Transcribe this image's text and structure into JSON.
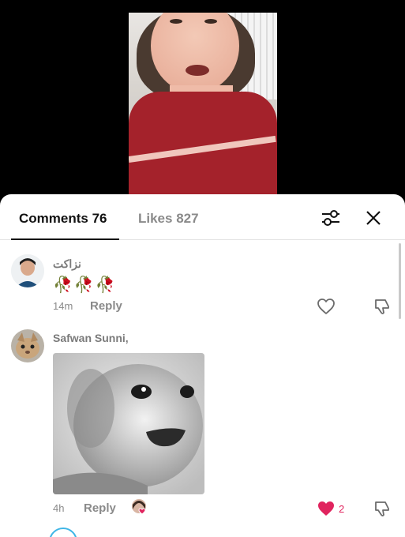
{
  "tabs": {
    "comments_label": "Comments 76",
    "likes_label": "Likes 827"
  },
  "comments": [
    {
      "username": "نزاکت",
      "emoji_text": "🥀🥀🥀",
      "time": "14m",
      "reply_label": "Reply"
    },
    {
      "username": "Safwan Sunni,",
      "time": "4h",
      "reply_label": "Reply",
      "like_count": "2",
      "liked": true
    }
  ],
  "colors": {
    "accent_like": "#e0245e",
    "muted": "#8a8a8a"
  },
  "icons": [
    "filter-icon",
    "close-icon",
    "heart-outline-icon",
    "dislike-icon",
    "heart-filled-icon"
  ]
}
